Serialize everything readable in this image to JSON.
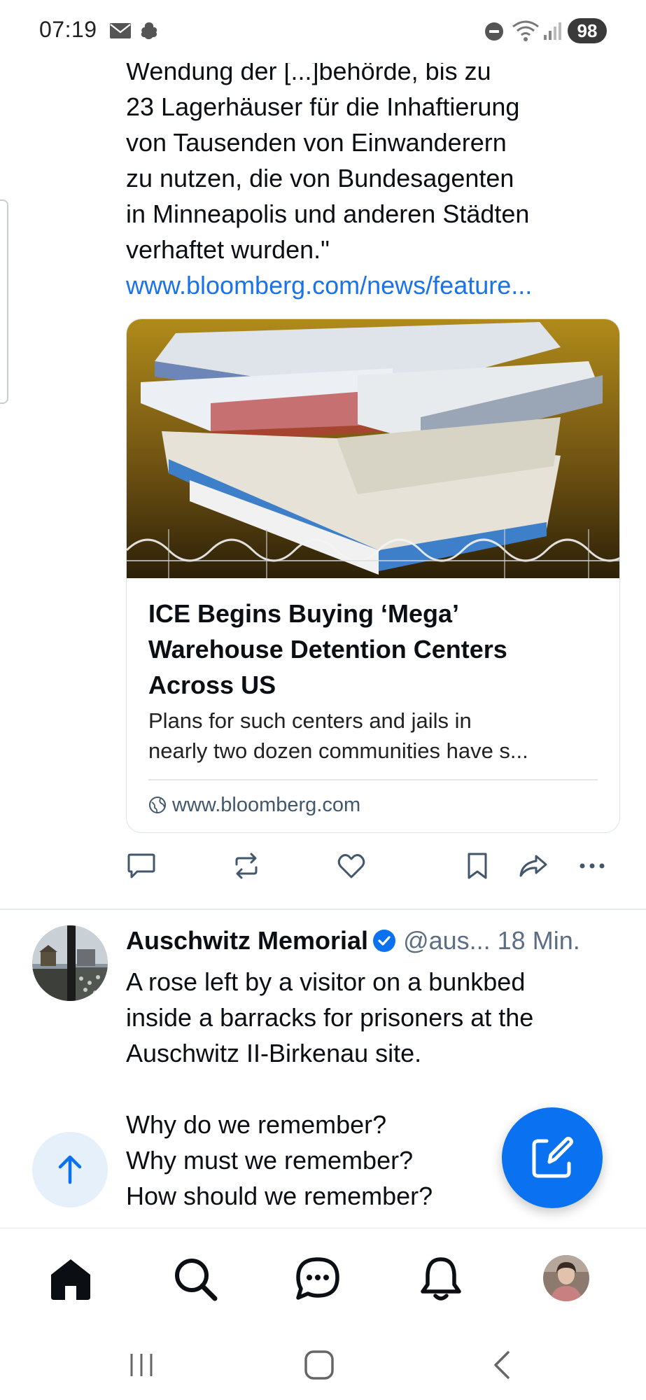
{
  "status_bar": {
    "time": "07:19",
    "battery": "98"
  },
  "post1": {
    "text_lines": [
      "Wendung der [...]behörde, bis zu",
      "23 Lagerhäuser für die Inhaftierung",
      "von Tausenden von Einwanderern",
      "zu nutzen, die von Bundesagenten",
      "in Minneapolis und anderen Städten",
      "verhaftet wurden.\""
    ],
    "link": "www.bloomberg.com/news/feature...",
    "card": {
      "title_lines": [
        "ICE Begins Buying ‘Mega’",
        "Warehouse Detention Centers",
        "Across US"
      ],
      "description_lines": [
        "Plans for such centers and jails in",
        "nearly two dozen communities have s..."
      ],
      "domain": "www.bloomberg.com"
    }
  },
  "post2": {
    "author": "Auschwitz Memorial",
    "handle": "@aus...",
    "time": "18 Min.",
    "text_lines": [
      "A rose left by a visitor on a bunkbed",
      "inside a barracks for prisoners at the",
      "Auschwitz II-Birkenau site.",
      "",
      "Why do we remember?",
      "Why must we remember?",
      "How should we remember?"
    ]
  },
  "colors": {
    "accent": "#0a72f0",
    "link": "#1a73e8",
    "muted": "#5c6e82"
  },
  "icons": [
    "reply-icon",
    "repost-icon",
    "like-icon",
    "bookmark-icon",
    "share-icon",
    "more-icon",
    "home-icon",
    "search-icon",
    "chat-icon",
    "notifications-icon",
    "compose-icon",
    "arrow-up-icon"
  ]
}
